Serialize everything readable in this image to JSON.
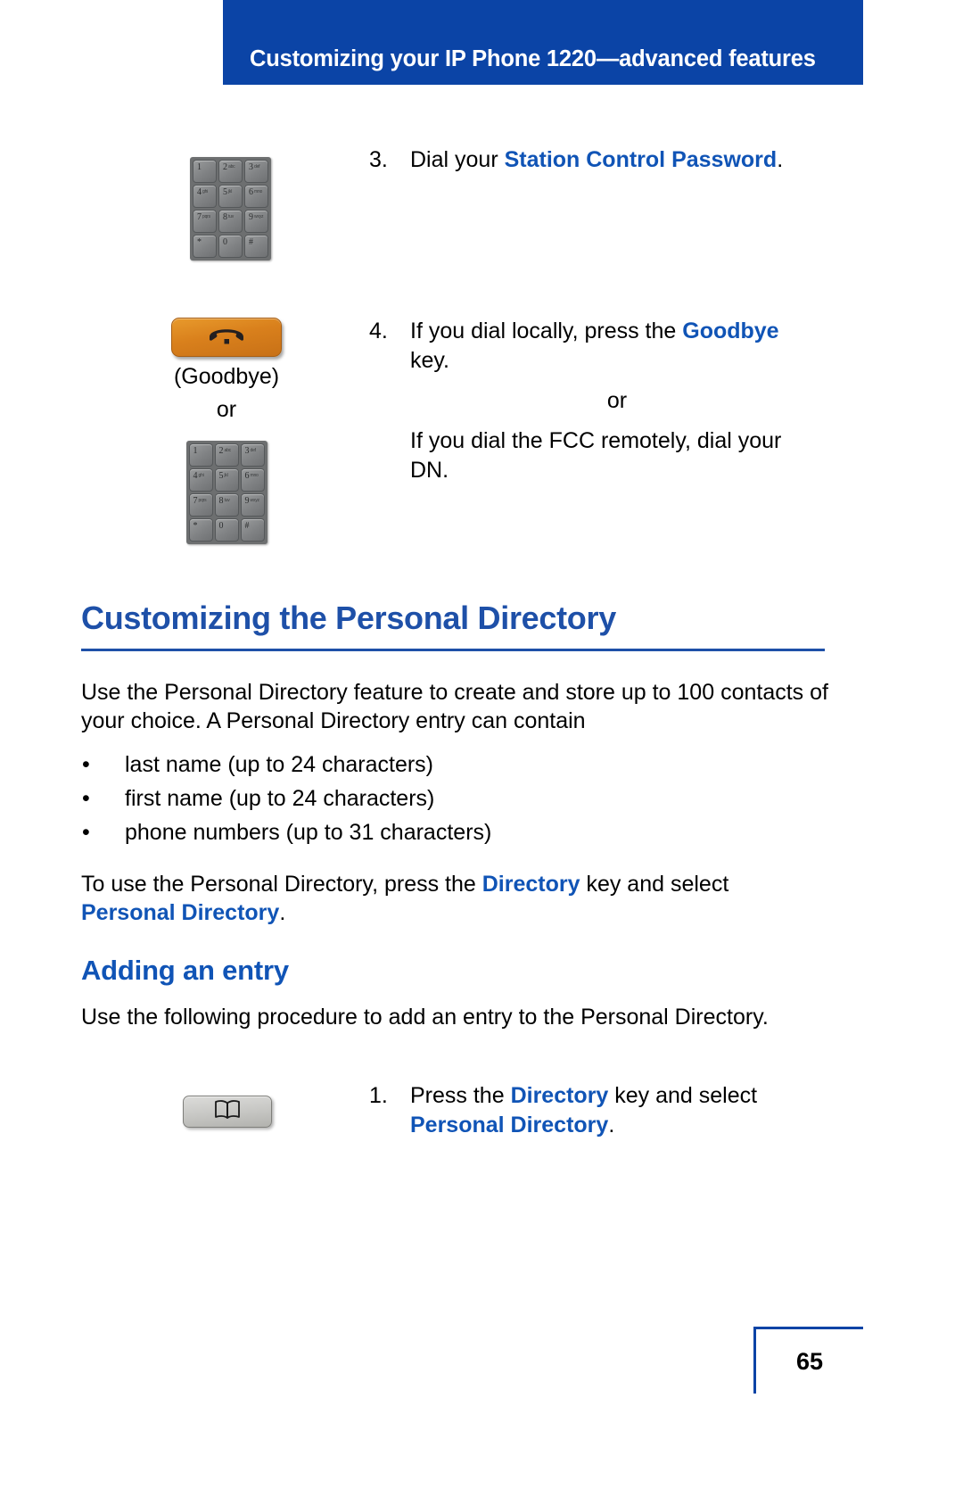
{
  "header": {
    "title": "Customizing your IP Phone 1220—advanced features",
    "bg_color": "#0b44a6",
    "text_color": "#ffffff"
  },
  "colors": {
    "accent_blue": "#1054b6",
    "heading_blue": "#1e50a8",
    "banner_blue": "#0b44a6",
    "goodbye_orange": "#d9801c",
    "keypad_gray": "#808284"
  },
  "keypad": {
    "keys": [
      {
        "digit": "1",
        "letters": ""
      },
      {
        "digit": "2",
        "letters": "abc"
      },
      {
        "digit": "3",
        "letters": "def"
      },
      {
        "digit": "4",
        "letters": "ghi"
      },
      {
        "digit": "5",
        "letters": "jkl"
      },
      {
        "digit": "6",
        "letters": "mno"
      },
      {
        "digit": "7",
        "letters": "pqrs"
      },
      {
        "digit": "8",
        "letters": "tuv"
      },
      {
        "digit": "9",
        "letters": "wxyz"
      },
      {
        "digit": "*",
        "letters": ""
      },
      {
        "digit": "0",
        "letters": ""
      },
      {
        "digit": "#",
        "letters": ""
      }
    ]
  },
  "steps": {
    "step3": {
      "number": "3.",
      "text_before": "Dial your ",
      "bold": "Station Control Password",
      "text_after": "."
    },
    "step4": {
      "number": "4.",
      "line1_before": "If you dial locally, press the ",
      "line1_bold": "Goodbye",
      "line1_after": " key.",
      "or": "or",
      "line2": "If you dial the FCC remotely, dial your DN."
    },
    "step1": {
      "number": "1.",
      "text_before": "Press the ",
      "bold1": "Directory",
      "text_middle": " key and select ",
      "bold2": "Personal Directory",
      "text_after": "."
    }
  },
  "icons": {
    "goodbye_caption": "(Goodbye)",
    "or_caption": "or"
  },
  "section": {
    "heading": "Customizing the Personal Directory",
    "intro": "Use the Personal Directory feature to create and store up to 100 contacts of your choice. A Personal Directory entry can contain",
    "bullets": [
      "last name (up to 24 characters)",
      "first name (up to 24 characters)",
      "phone numbers (up to 31 characters)"
    ],
    "usage_before": "To use the Personal Directory, press the ",
    "usage_bold1": "Directory",
    "usage_middle": " key and select ",
    "usage_bold2": "Personal Directory",
    "usage_after": "."
  },
  "subsection": {
    "heading": "Adding an entry",
    "intro": "Use the following procedure to add an entry to the Personal Directory."
  },
  "footer": {
    "page_number": "65"
  }
}
